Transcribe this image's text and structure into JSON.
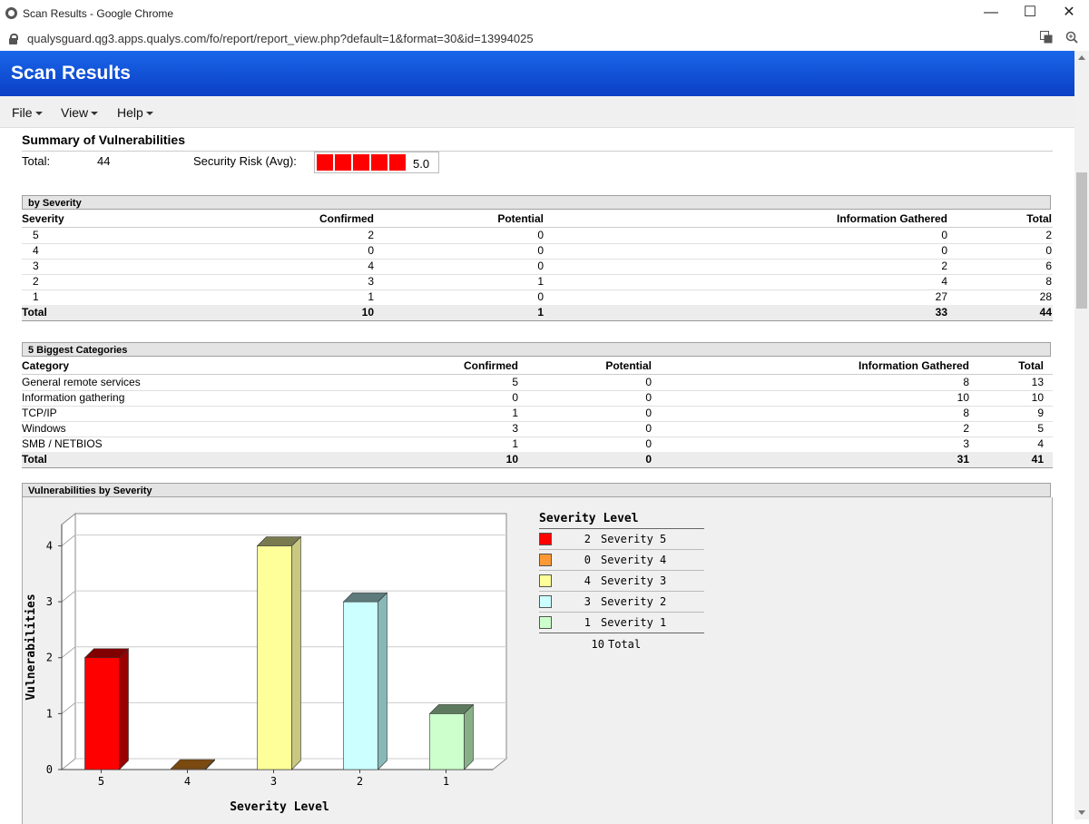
{
  "window": {
    "title": "Scan Results - Google Chrome",
    "url": "qualysguard.qg3.apps.qualys.com/fo/report/report_view.php?default=1&format=30&id=13994025",
    "controls": [
      "—",
      "☐",
      "✕"
    ]
  },
  "header": {
    "title": "Scan Results"
  },
  "menu": [
    {
      "label": "File"
    },
    {
      "label": "View"
    },
    {
      "label": "Help"
    }
  ],
  "summary": {
    "title": "Summary of Vulnerabilities",
    "total_label": "Total:",
    "total_value": "44",
    "risk_label": "Security Risk (Avg):",
    "risk_value": "5.0",
    "risk_level": 5,
    "risk_color": "#ff0000"
  },
  "by_severity": {
    "title": "by Severity",
    "headers": [
      "Severity",
      "Confirmed",
      "Potential",
      "Information Gathered",
      "Total"
    ],
    "rows": [
      [
        "5",
        "2",
        "0",
        "0",
        "2"
      ],
      [
        "4",
        "0",
        "0",
        "0",
        "0"
      ],
      [
        "3",
        "4",
        "0",
        "2",
        "6"
      ],
      [
        "2",
        "3",
        "1",
        "4",
        "8"
      ],
      [
        "1",
        "1",
        "0",
        "27",
        "28"
      ]
    ],
    "total": [
      "Total",
      "10",
      "1",
      "33",
      "44"
    ]
  },
  "categories": {
    "title": "5 Biggest Categories",
    "headers": [
      "Category",
      "Confirmed",
      "Potential",
      "Information Gathered",
      "Total"
    ],
    "rows": [
      [
        "General remote services",
        "5",
        "0",
        "8",
        "13"
      ],
      [
        "Information gathering",
        "0",
        "0",
        "10",
        "10"
      ],
      [
        "TCP/IP",
        "1",
        "0",
        "8",
        "9"
      ],
      [
        "Windows",
        "3",
        "0",
        "2",
        "5"
      ],
      [
        "SMB / NETBIOS",
        "1",
        "0",
        "3",
        "4"
      ]
    ],
    "total": [
      "Total",
      "10",
      "0",
      "31",
      "41"
    ]
  },
  "chart_section": {
    "title": "Vulnerabilities by Severity"
  },
  "chart_data": {
    "type": "bar",
    "categories": [
      "5",
      "4",
      "3",
      "2",
      "1"
    ],
    "values": [
      2,
      0,
      4,
      3,
      1
    ],
    "colors": [
      "#ff0000",
      "#ff9933",
      "#ffff99",
      "#ccffff",
      "#ccffcc"
    ],
    "side_colors": [
      "#990000",
      "#8b4513",
      "#c8c880",
      "#88b8b8",
      "#88b088"
    ],
    "top_colors": [
      "#800000",
      "#7a4a10",
      "#7a7a50",
      "#5e7a7a",
      "#5e7a5e"
    ],
    "xlabel": "Severity Level",
    "ylabel": "Vulnerabilities",
    "yticks": [
      "0",
      "1",
      "2",
      "3",
      "4"
    ],
    "ylim": [
      0,
      4.3
    ],
    "legend_title": "Severity Level",
    "legend": [
      {
        "count": "2",
        "label": "Severity 5"
      },
      {
        "count": "0",
        "label": "Severity 4"
      },
      {
        "count": "4",
        "label": "Severity 3"
      },
      {
        "count": "3",
        "label": "Severity 2"
      },
      {
        "count": "1",
        "label": "Severity 1"
      }
    ],
    "legend_total": {
      "count": "10",
      "label": "Total"
    }
  }
}
